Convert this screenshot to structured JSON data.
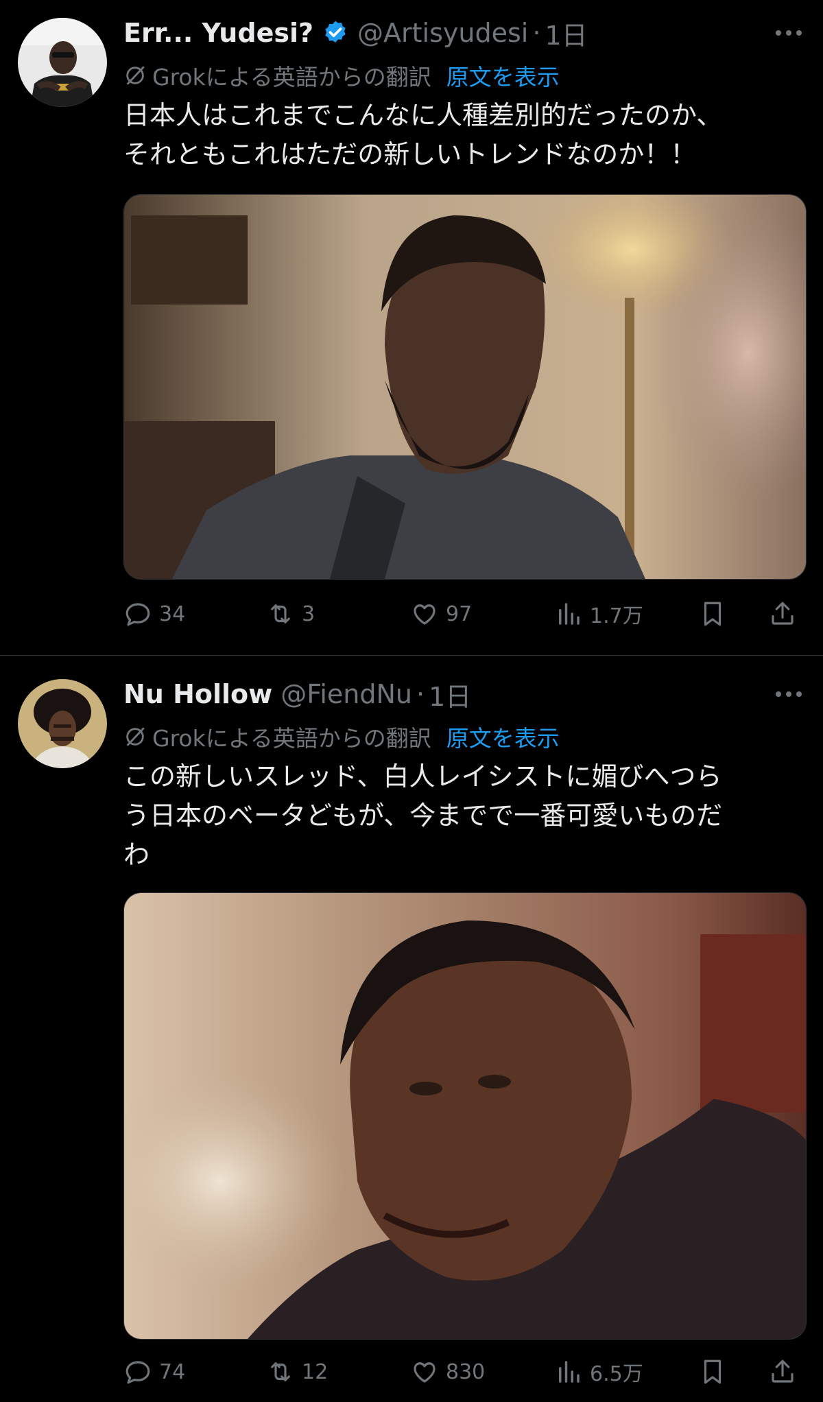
{
  "tweets": [
    {
      "display_name": "Err... Yudesi?",
      "verified": true,
      "handle": "@Artisyudesi",
      "separator": "·",
      "time": "1日",
      "translation_note": "Grokによる英語からの翻訳",
      "show_original": "原文を表示",
      "text": "日本人はこれまでこんなに人種差別的だったのか、\nそれともこれはただの新しいトレンドなのか！！",
      "media_icon": "photo-man-side-eye",
      "stats": {
        "replies": "34",
        "retweets": "3",
        "likes": "97",
        "views": "1.7万"
      }
    },
    {
      "display_name": "Nu Hollow",
      "verified": false,
      "handle": "@FiendNu",
      "separator": "·",
      "time": "1日",
      "translation_note": "Grokによる英語からの翻訳",
      "show_original": "原文を表示",
      "text": "この新しいスレッド、白人レイシストに媚びへつら\nう日本のベータどもが、今までで一番可愛いものだ\nわ",
      "media_icon": "photo-man-smirk",
      "stats": {
        "replies": "74",
        "retweets": "12",
        "likes": "830",
        "views": "6.5万"
      }
    }
  ],
  "colors": {
    "background": "#000000",
    "primary_text": "#e7e9ea",
    "secondary_text": "#71767b",
    "link_blue": "#1d9bf0",
    "divider": "#2f3336"
  }
}
